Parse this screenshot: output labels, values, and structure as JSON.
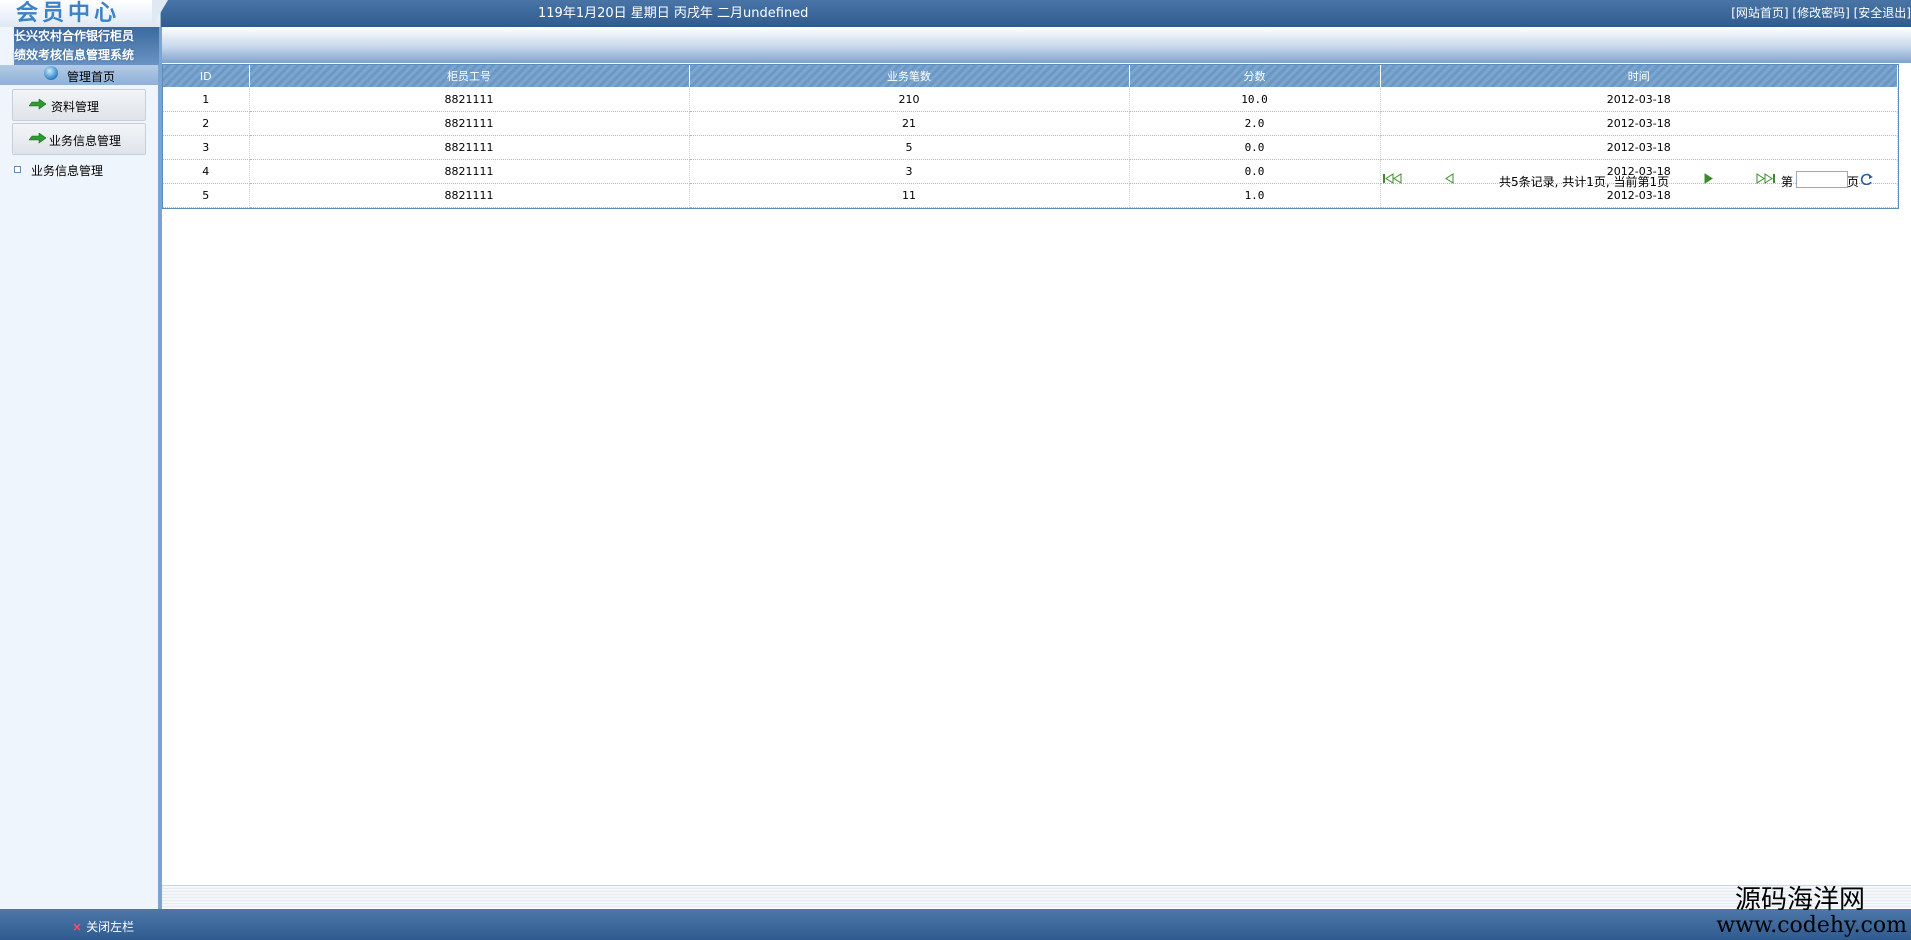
{
  "header": {
    "logo": "会员中心",
    "datetime": "119年1月20日 星期日 丙戌年 二月undefined",
    "links": [
      "[网站首页]",
      "[修改密码]",
      "[安全退出]"
    ]
  },
  "sidebar": {
    "system_title_line1": "长兴农村合作银行柜员",
    "system_title_line2": "绩效考核信息管理系统",
    "home": "管理首页",
    "menus": [
      {
        "label": "资料管理"
      },
      {
        "label": "业务信息管理"
      }
    ],
    "subitems": [
      {
        "label": "业务信息管理"
      }
    ]
  },
  "table": {
    "columns": [
      "ID",
      "柜员工号",
      "业务笔数",
      "分数",
      "时间"
    ],
    "rows": [
      [
        "1",
        "8821111",
        "210",
        "10.0",
        "2012-03-18"
      ],
      [
        "2",
        "8821111",
        "21",
        "2.0",
        "2012-03-18"
      ],
      [
        "3",
        "8821111",
        "5",
        "0.0",
        "2012-03-18"
      ],
      [
        "4",
        "8821111",
        "3",
        "0.0",
        "2012-03-18"
      ],
      [
        "5",
        "8821111",
        "11",
        "1.0",
        "2012-03-18"
      ]
    ]
  },
  "pager": {
    "summary": "共5条记录, 共计1页, 当前第1页",
    "page_prefix": "第",
    "page_suffix": "页",
    "page_input_value": "",
    "icons": [
      "first-page-icon",
      "prev-page-icon",
      "next-page-icon",
      "last-page-icon",
      "go-refresh-icon"
    ],
    "accent": "#3a8c2a"
  },
  "footer": {
    "close_sidebar": "关闭左栏"
  },
  "watermark": {
    "line1": "源码海洋网",
    "line2": "www.codehy.com"
  },
  "colors": {
    "topbar": "#3a6899",
    "sidebar_bg": "#eef5fd",
    "table_header": "#7ba6cf"
  }
}
